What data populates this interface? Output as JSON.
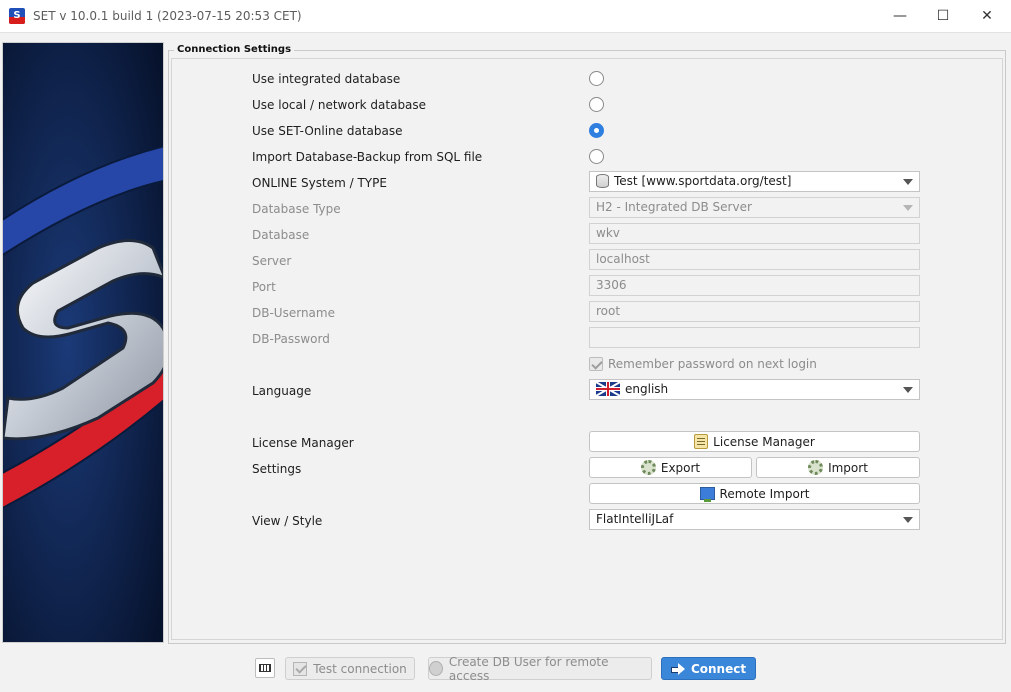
{
  "window": {
    "title": "SET v 10.0.1 build 1 (2023-07-15 20:53 CET)",
    "minimize_glyph": "—",
    "maximize_glyph": "☐",
    "close_glyph": "✕",
    "app_icon_letter": "S"
  },
  "group": {
    "title": "Connection Settings"
  },
  "options": {
    "integrated_label": "Use integrated database",
    "integrated_selected": false,
    "local_network_label": "Use local / network database",
    "local_network_selected": false,
    "set_online_label": "Use SET-Online database",
    "set_online_selected": true,
    "import_backup_label": "Import Database-Backup from SQL file",
    "import_backup_selected": false
  },
  "form": {
    "online_system_label": "ONLINE System / TYPE",
    "online_system_value": "Test [www.sportdata.org/test]",
    "db_type_label": "Database Type",
    "db_type_value": "H2 - Integrated DB Server",
    "database_label": "Database",
    "database_value": "wkv",
    "server_label": "Server",
    "server_value": "localhost",
    "port_label": "Port",
    "port_value": "3306",
    "username_label": "DB-Username",
    "username_value": "root",
    "password_label": "DB-Password",
    "password_value": "",
    "remember_label": "Remember password on next login",
    "remember_checked": true,
    "language_label": "Language",
    "language_value": "english",
    "license_label": "License Manager",
    "license_button": "License Manager",
    "settings_label": "Settings",
    "export_button": "Export",
    "import_button": "Import",
    "remote_import_button": "Remote Import",
    "view_style_label": "View / Style",
    "view_style_value": "FlatIntelliJLaf"
  },
  "footer": {
    "test_connection": "Test connection",
    "create_db_user": "Create DB User for remote access",
    "connect": "Connect"
  },
  "colors": {
    "accent": "#3a86d9",
    "banner_blue": "#1e3f96",
    "banner_red": "#d8202a"
  }
}
